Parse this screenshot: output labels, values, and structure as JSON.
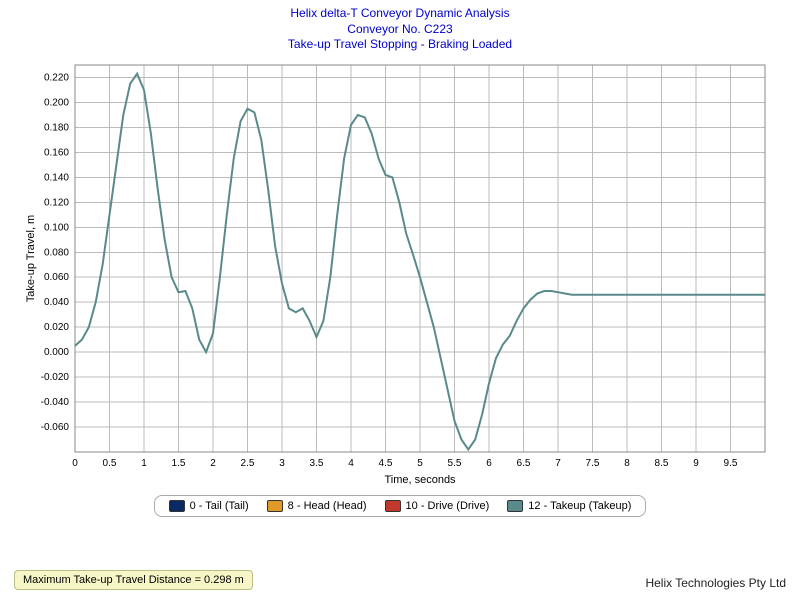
{
  "titles": {
    "line1": "Helix delta-T Conveyor Dynamic Analysis",
    "line2": "Conveyor No. C223",
    "line3": "Take-up Travel Stopping - Braking Loaded"
  },
  "axes": {
    "xlabel": "Time, seconds",
    "ylabel": "Take-up Travel, m"
  },
  "legend": {
    "items": [
      {
        "label": "0 - Tail (Tail)",
        "color": "#0a2a66"
      },
      {
        "label": "8 - Head (Head)",
        "color": "#e09a2a"
      },
      {
        "label": "10 - Drive (Drive)",
        "color": "#c0392b"
      },
      {
        "label": "12 - Takeup (Takeup)",
        "color": "#5a8a8a"
      }
    ]
  },
  "status": {
    "max_travel_text": "Maximum Take-up Travel Distance = 0.298 m"
  },
  "brand": "Helix Technologies Pty Ltd",
  "chart_data": {
    "type": "line",
    "title": "Take-up Travel Stopping - Braking Loaded",
    "xlabel": "Time, seconds",
    "ylabel": "Take-up Travel, m",
    "xlim": [
      0,
      10
    ],
    "ylim": [
      -0.08,
      0.23
    ],
    "xticks": [
      0,
      0.5,
      1,
      1.5,
      2,
      2.5,
      3,
      3.5,
      4,
      4.5,
      5,
      5.5,
      6,
      6.5,
      7,
      7.5,
      8,
      8.5,
      9,
      9.5
    ],
    "yticks": [
      -0.06,
      -0.04,
      -0.02,
      0.0,
      0.02,
      0.04,
      0.06,
      0.08,
      0.1,
      0.12,
      0.14,
      0.16,
      0.18,
      0.2,
      0.22
    ],
    "series": [
      {
        "name": "12 - Takeup (Takeup)",
        "color": "#5a8a8a",
        "x": [
          0.0,
          0.1,
          0.2,
          0.3,
          0.4,
          0.5,
          0.6,
          0.7,
          0.8,
          0.9,
          1.0,
          1.1,
          1.2,
          1.3,
          1.4,
          1.5,
          1.6,
          1.7,
          1.8,
          1.9,
          2.0,
          2.1,
          2.2,
          2.3,
          2.4,
          2.5,
          2.6,
          2.7,
          2.8,
          2.9,
          3.0,
          3.1,
          3.2,
          3.3,
          3.4,
          3.5,
          3.6,
          3.7,
          3.8,
          3.9,
          4.0,
          4.1,
          4.2,
          4.3,
          4.4,
          4.5,
          4.6,
          4.7,
          4.8,
          4.9,
          5.0,
          5.1,
          5.2,
          5.3,
          5.4,
          5.5,
          5.6,
          5.7,
          5.8,
          5.9,
          6.0,
          6.1,
          6.2,
          6.3,
          6.4,
          6.5,
          6.6,
          6.7,
          6.8,
          6.9,
          7.0,
          7.1,
          7.2,
          7.3,
          7.5,
          8.0,
          8.5,
          9.0,
          9.5,
          10.0
        ],
        "y": [
          0.005,
          0.01,
          0.02,
          0.04,
          0.07,
          0.11,
          0.15,
          0.19,
          0.215,
          0.223,
          0.21,
          0.175,
          0.13,
          0.09,
          0.06,
          0.048,
          0.049,
          0.035,
          0.01,
          0.0,
          0.015,
          0.06,
          0.11,
          0.155,
          0.185,
          0.195,
          0.192,
          0.17,
          0.13,
          0.085,
          0.055,
          0.035,
          0.032,
          0.035,
          0.025,
          0.012,
          0.025,
          0.06,
          0.11,
          0.155,
          0.182,
          0.19,
          0.188,
          0.175,
          0.155,
          0.142,
          0.14,
          0.12,
          0.095,
          0.078,
          0.06,
          0.04,
          0.02,
          -0.005,
          -0.03,
          -0.055,
          -0.07,
          -0.078,
          -0.07,
          -0.05,
          -0.025,
          -0.005,
          0.006,
          0.013,
          0.025,
          0.035,
          0.042,
          0.047,
          0.049,
          0.049,
          0.048,
          0.047,
          0.046,
          0.046,
          0.046,
          0.046,
          0.046,
          0.046,
          0.046,
          0.046
        ]
      }
    ]
  }
}
